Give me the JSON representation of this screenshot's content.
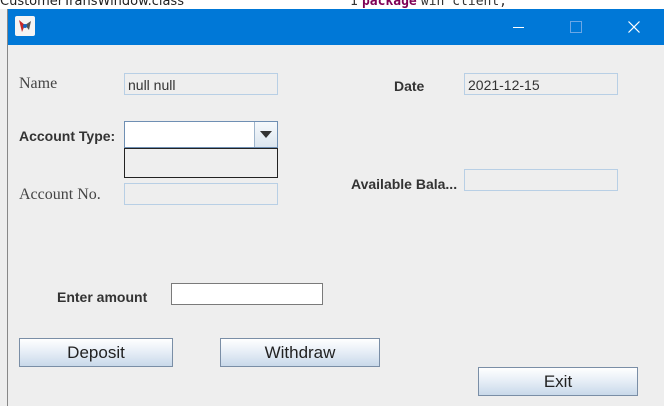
{
  "background": {
    "left_text": "CustomerTransWindow.class",
    "right_line_number": "1",
    "right_keyword": "package",
    "right_code": "win client;"
  },
  "window": {
    "title": "",
    "colors": {
      "titlebar": "#0078d7",
      "background": "#eeeeee",
      "field_border": "#b8cfe5"
    }
  },
  "form": {
    "name_label": "Name",
    "name_value": "null null",
    "date_label": "Date",
    "date_value": "2021-12-15",
    "account_type_label": "Account Type:",
    "account_type_value": "",
    "account_no_label": "Account No.",
    "account_no_value": "",
    "available_balance_label": "Available Bala...",
    "available_balance_value": "",
    "enter_amount_label": "Enter amount",
    "enter_amount_value": ""
  },
  "buttons": {
    "deposit": "Deposit",
    "withdraw": "Withdraw",
    "exit": "Exit"
  },
  "icons": {
    "app": "java-app-icon",
    "minimize": "minimize-icon",
    "maximize": "maximize-icon",
    "close": "close-icon",
    "dropdown": "chevron-down-icon"
  }
}
